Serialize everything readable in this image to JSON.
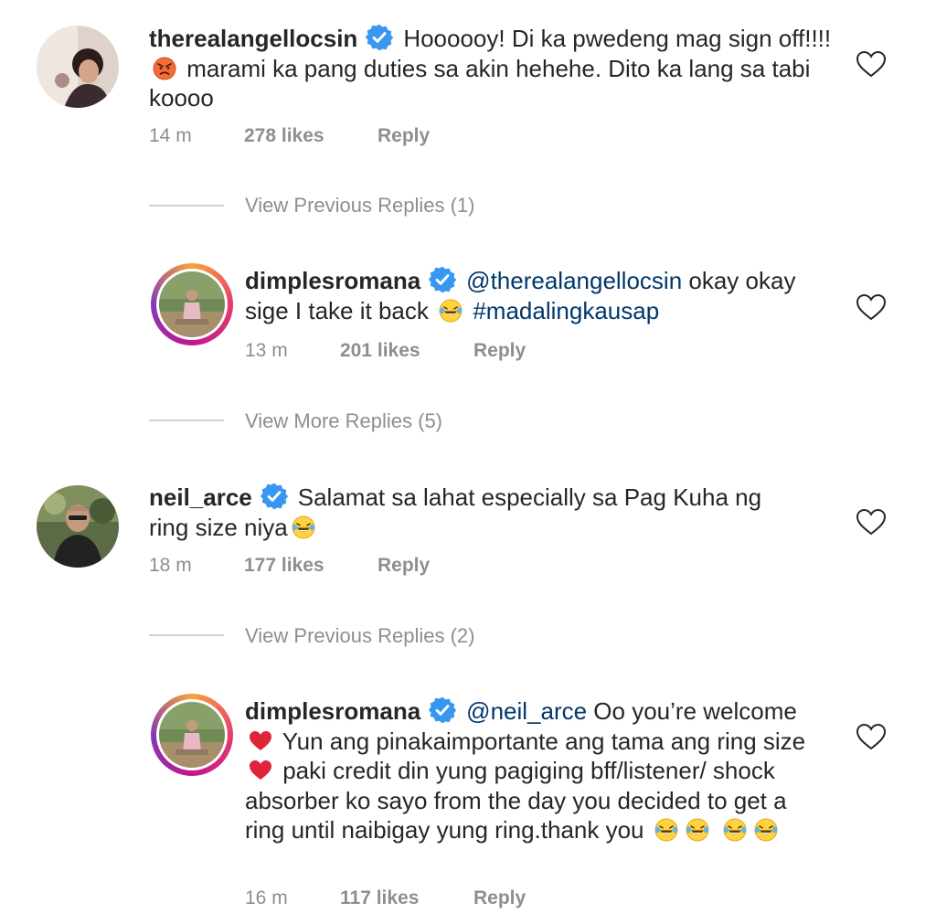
{
  "comments": [
    {
      "username": "therealangellocsin",
      "text_a": "Hoooooy! Di ka pwedeng mag sign off!!!!",
      "text_b": " marami ka pang duties sa akin hehehe. Dito ka lang sa tabi koooo",
      "time": "14 m",
      "likes": "278 likes",
      "reply": "Reply"
    },
    {
      "view_replies": "View Previous Replies (1)"
    },
    {
      "username": "dimplesromana",
      "mention": "@therealangellocsin",
      "text_a": " okay okay sige I take it back ",
      "hashtag": "#madalingkausap",
      "time": "13 m",
      "likes": "201 likes",
      "reply": "Reply"
    },
    {
      "view_replies": "View More Replies (5)"
    },
    {
      "username": "neil_arce",
      "text_a": "Salamat sa lahat especially sa Pag Kuha ng ring size niya",
      "time": "18 m",
      "likes": "177 likes",
      "reply": "Reply"
    },
    {
      "view_replies": "View Previous Replies (2)"
    },
    {
      "username": "dimplesromana",
      "mention": "@neil_arce",
      "text_a": " Oo you’re welcome ",
      "text_b": " Yun ang pinakaimportante ang tama ang ring size ",
      "text_c": " paki credit din yung pagiging bff/listener/ shock absorber ko sayo from the day you decided to get a ring until naibigay yung ring.thank you ",
      "time": "16 m",
      "likes": "117 likes",
      "reply": "Reply"
    }
  ],
  "icons": {
    "verified": "verified-badge-icon",
    "heart": "heart-outline-icon",
    "angry": "angry-face-emoji",
    "laughing": "tears-of-joy-emoji",
    "red_heart": "red-heart-emoji"
  },
  "colors": {
    "text": "#262626",
    "meta": "#8e8e8e",
    "link": "#00376b",
    "verified": "#3897f0"
  }
}
